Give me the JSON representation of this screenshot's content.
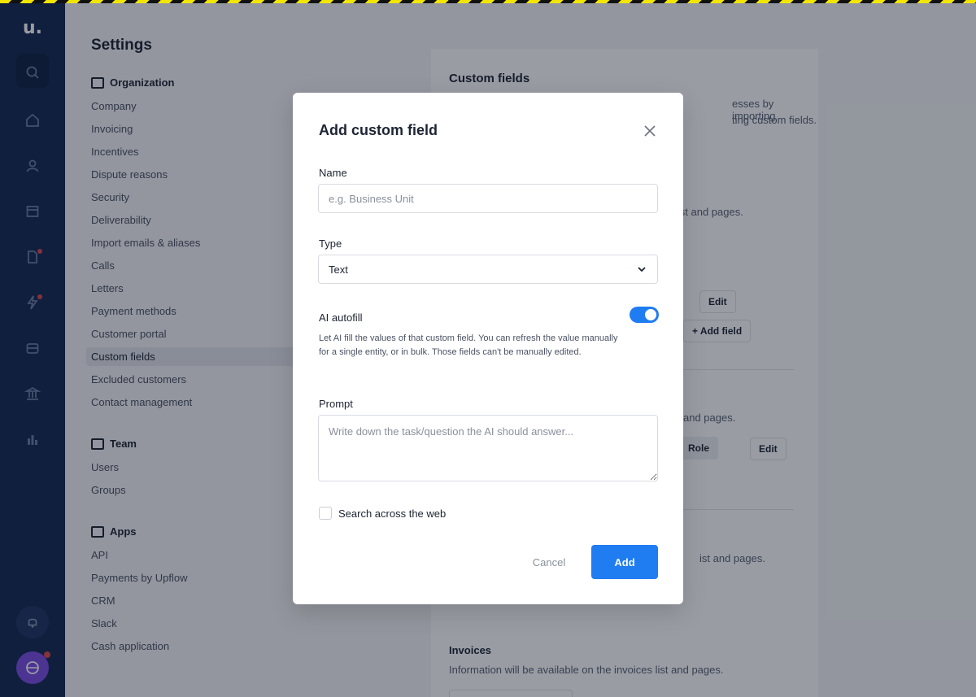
{
  "app": {
    "logo_text": "u.",
    "colors": {
      "rail": "#142851",
      "accent": "#1f7cf1",
      "badge": "#e0474c",
      "avatar": "#7a4de4"
    }
  },
  "rail_icons": [
    "search-icon",
    "home-icon",
    "user-icon",
    "calendar-icon",
    "document-icon",
    "lightning-icon",
    "inbox-icon",
    "bank-icon",
    "bar-chart-icon"
  ],
  "settings": {
    "title": "Settings",
    "organization": {
      "title": "Organization",
      "items": [
        "Company",
        "Invoicing",
        "Incentives",
        "Dispute reasons",
        "Security",
        "Deliverability",
        "Import emails & aliases",
        "Calls",
        "Letters",
        "Payment methods",
        "Customer portal",
        "Custom fields",
        "Excluded customers",
        "Contact management"
      ],
      "active": "Custom fields"
    },
    "team": {
      "title": "Team",
      "items": [
        "Users",
        "Groups"
      ]
    },
    "apps": {
      "title": "Apps",
      "items": [
        "API",
        "Payments by Upflow",
        "CRM",
        "Slack",
        "Cash application"
      ]
    }
  },
  "content": {
    "title": "Custom fields",
    "intro_line1": "esses by importing",
    "intro_line2": "ting custom fields.",
    "frag1": "list and pages.",
    "edit_label": "Edit",
    "add_field_label": "+ Add field",
    "frag2": "and pages.",
    "role_chip": "Role",
    "frag3": "ist and pages.",
    "invoices_title": "Invoices",
    "invoices_desc": "Information will be available on the invoices list and pages."
  },
  "modal": {
    "title": "Add custom field",
    "name_label": "Name",
    "name_placeholder": "e.g. Business Unit",
    "type_label": "Type",
    "type_value": "Text",
    "ai_label": "AI autofill",
    "ai_enabled": true,
    "ai_help": "Let AI fill the values of that custom field. You can refresh the value manually for a single entity, or in bulk. Those fields can't be manually edited.",
    "prompt_label": "Prompt",
    "prompt_placeholder": "Write down the task/question the AI should answer...",
    "search_web_label": "Search across the web",
    "search_web_checked": false,
    "cancel_label": "Cancel",
    "add_label": "Add"
  }
}
